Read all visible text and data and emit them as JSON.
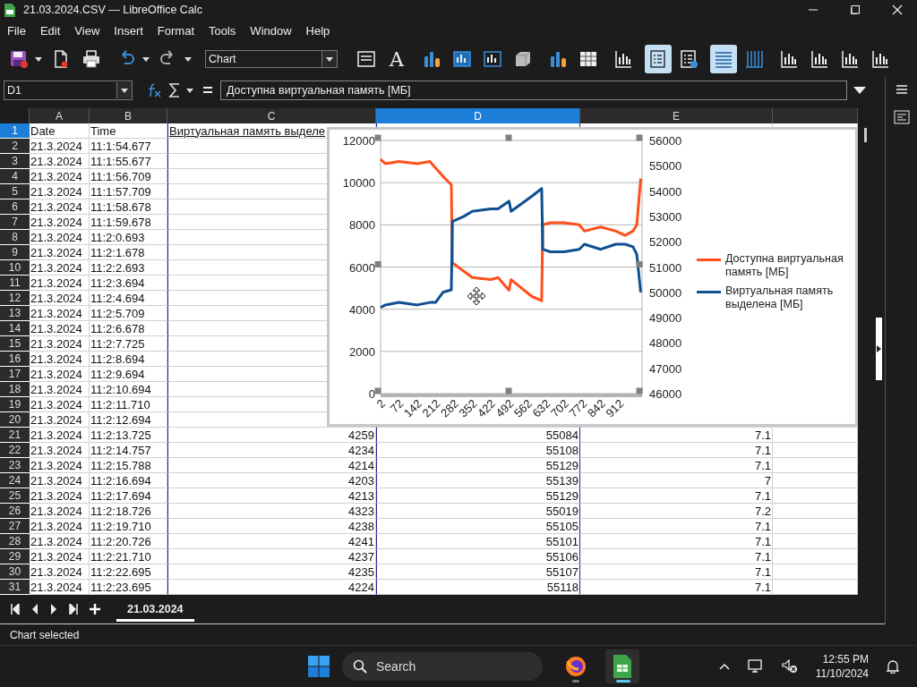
{
  "window": {
    "title": "21.03.2024.CSV — LibreOffice Calc"
  },
  "menu": [
    "File",
    "Edit",
    "View",
    "Insert",
    "Format",
    "Tools",
    "Window",
    "Help"
  ],
  "toolbar": [
    {
      "items": [
        {
          "kind": "floppy",
          "selected": false
        },
        {
          "kind": "pdf",
          "selected": false
        },
        {
          "kind": "printer",
          "selected": false
        }
      ]
    },
    {
      "items": [
        {
          "kind": "undo",
          "selected": false
        },
        {
          "kind": "redo",
          "selected": false
        }
      ]
    },
    {
      "items": [
        {
          "kind": "select",
          "value": "Chart"
        }
      ]
    },
    {
      "items": [
        {
          "kind": "format",
          "selected": false
        },
        {
          "kind": "glyph",
          "glyph": "A",
          "selected": false
        }
      ]
    },
    {
      "items": [
        {
          "kind": "chart-type",
          "selected": false
        },
        {
          "kind": "chart-area",
          "selected": false
        },
        {
          "kind": "chart-wall",
          "selected": false
        },
        {
          "kind": "cube",
          "selected": false
        }
      ]
    },
    {
      "items": [
        {
          "kind": "data-ranges",
          "selected": false
        },
        {
          "kind": "data-table",
          "selected": false
        }
      ]
    },
    {
      "items": [
        {
          "kind": "axes",
          "selected": false
        }
      ]
    },
    {
      "items": [
        {
          "kind": "legend",
          "selected": true
        },
        {
          "kind": "legend-options",
          "selected": false
        }
      ]
    },
    {
      "items": [
        {
          "kind": "hgrid",
          "selected": true
        },
        {
          "kind": "vgrid",
          "selected": false
        }
      ]
    },
    {
      "items": [
        {
          "kind": "axes",
          "selected": false
        },
        {
          "kind": "axes",
          "selected": false
        },
        {
          "kind": "axes",
          "selected": false
        },
        {
          "kind": "axes",
          "selected": false
        }
      ]
    }
  ],
  "name_box": {
    "value": "D1"
  },
  "formula": {
    "value": "Доступна виртуальная память [МБ]"
  },
  "sheet": {
    "columns": [
      {
        "label": "A",
        "selected": false,
        "in_chart_range": false
      },
      {
        "label": "B",
        "selected": false,
        "in_chart_range": false
      },
      {
        "label": "C",
        "selected": false,
        "in_chart_range": true
      },
      {
        "label": "D",
        "selected": true,
        "in_chart_range": true
      },
      {
        "label": "E",
        "selected": false,
        "in_chart_range": false
      }
    ],
    "rows": [
      {
        "number": "1",
        "selected": true,
        "a": "Date",
        "b": "Time",
        "c": "Виртуальная память выделе"
      },
      {
        "number": "2",
        "selected": false,
        "a": "21.3.2024",
        "b": "11:1:54.677"
      },
      {
        "number": "3",
        "selected": false,
        "a": "21.3.2024",
        "b": "11:1:55.677"
      },
      {
        "number": "4",
        "selected": false,
        "a": "21.3.2024",
        "b": "11:1:56.709"
      },
      {
        "number": "5",
        "selected": false,
        "a": "21.3.2024",
        "b": "11:1:57.709"
      },
      {
        "number": "6",
        "selected": false,
        "a": "21.3.2024",
        "b": "11:1:58.678"
      },
      {
        "number": "7",
        "selected": false,
        "a": "21.3.2024",
        "b": "11:1:59.678"
      },
      {
        "number": "8",
        "selected": false,
        "a": "21.3.2024",
        "b": "11:2:0.693"
      },
      {
        "number": "9",
        "selected": false,
        "a": "21.3.2024",
        "b": "11:2:1.678"
      },
      {
        "number": "10",
        "selected": false,
        "a": "21.3.2024",
        "b": "11:2:2.693"
      },
      {
        "number": "11",
        "selected": false,
        "a": "21.3.2024",
        "b": "11:2:3.694"
      },
      {
        "number": "12",
        "selected": false,
        "a": "21.3.2024",
        "b": "11:2:4.694"
      },
      {
        "number": "13",
        "selected": false,
        "a": "21.3.2024",
        "b": "11:2:5.709"
      },
      {
        "number": "14",
        "selected": false,
        "a": "21.3.2024",
        "b": "11:2:6.678"
      },
      {
        "number": "15",
        "selected": false,
        "a": "21.3.2024",
        "b": "11:2:7.725"
      },
      {
        "number": "16",
        "selected": false,
        "a": "21.3.2024",
        "b": "11:2:8.694"
      },
      {
        "number": "17",
        "selected": false,
        "a": "21.3.2024",
        "b": "11:2:9.694"
      },
      {
        "number": "18",
        "selected": false,
        "a": "21.3.2024",
        "b": "11:2:10.694"
      },
      {
        "number": "19",
        "selected": false,
        "a": "21.3.2024",
        "b": "11:2:11.710"
      },
      {
        "number": "20",
        "selected": false,
        "a": "21.3.2024",
        "b": "11:2:12.694"
      },
      {
        "number": "21",
        "selected": false,
        "a": "21.3.2024",
        "b": "11:2:13.725",
        "c": "4259",
        "d": "55084",
        "e": "7.1"
      },
      {
        "number": "22",
        "selected": false,
        "a": "21.3.2024",
        "b": "11:2:14.757",
        "c": "4234",
        "d": "55108",
        "e": "7.1"
      },
      {
        "number": "23",
        "selected": false,
        "a": "21.3.2024",
        "b": "11:2:15.788",
        "c": "4214",
        "d": "55129",
        "e": "7.1"
      },
      {
        "number": "24",
        "selected": false,
        "a": "21.3.2024",
        "b": "11:2:16.694",
        "c": "4203",
        "d": "55139",
        "e": "7"
      },
      {
        "number": "25",
        "selected": false,
        "a": "21.3.2024",
        "b": "11:2:17.694",
        "c": "4213",
        "d": "55129",
        "e": "7.1"
      },
      {
        "number": "26",
        "selected": false,
        "a": "21.3.2024",
        "b": "11:2:18.726",
        "c": "4323",
        "d": "55019",
        "e": "7.2"
      },
      {
        "number": "27",
        "selected": false,
        "a": "21.3.2024",
        "b": "11:2:19.710",
        "c": "4238",
        "d": "55105",
        "e": "7.1"
      },
      {
        "number": "28",
        "selected": false,
        "a": "21.3.2024",
        "b": "11:2:20.726",
        "c": "4241",
        "d": "55101",
        "e": "7.1"
      },
      {
        "number": "29",
        "selected": false,
        "a": "21.3.2024",
        "b": "11:2:21.710",
        "c": "4237",
        "d": "55106",
        "e": "7.1"
      },
      {
        "number": "30",
        "selected": false,
        "a": "21.3.2024",
        "b": "11:2:22.695",
        "c": "4235",
        "d": "55107",
        "e": "7.1"
      },
      {
        "number": "31",
        "selected": false,
        "a": "21.3.2024",
        "b": "11:2:23.695",
        "c": "4224",
        "d": "55118",
        "e": "7.1"
      }
    ]
  },
  "chart": {
    "chart_data": {
      "type": "line",
      "grid": true,
      "legend": "right",
      "xlim": [
        2,
        1000
      ],
      "ylim": [
        0,
        12000
      ],
      "y2lim": [
        46000,
        56000
      ],
      "xticks": [
        2,
        72,
        142,
        212,
        282,
        352,
        422,
        492,
        562,
        632,
        702,
        772,
        842,
        912
      ],
      "yticks": [
        0,
        2000,
        4000,
        6000,
        8000,
        10000,
        12000
      ],
      "y2ticks": [
        46000,
        47000,
        48000,
        49000,
        50000,
        51000,
        52000,
        53000,
        54000,
        55000,
        56000
      ],
      "x": [
        2,
        20,
        72,
        142,
        190,
        212,
        240,
        272,
        276,
        320,
        352,
        422,
        450,
        492,
        500,
        540,
        580,
        617,
        621,
        650,
        702,
        760,
        780,
        842,
        900,
        935,
        965,
        980,
        995
      ],
      "series": [
        {
          "name": "Доступна виртуальная память [МБ]",
          "color": "#ff4f1a",
          "axis": "y",
          "values": [
            11100,
            10900,
            11000,
            10900,
            11000,
            10700,
            10300,
            9900,
            6200,
            5800,
            5500,
            5400,
            5500,
            4900,
            5400,
            5000,
            4600,
            4400,
            8000,
            8100,
            8100,
            8000,
            7700,
            7900,
            7700,
            7500,
            7700,
            8000,
            10200
          ]
        },
        {
          "name": "Виртуальная память выделена [МБ]",
          "color": "#0f4f8f",
          "axis": "y2",
          "values": [
            49400,
            49500,
            49600,
            49500,
            49600,
            49600,
            50000,
            50100,
            52800,
            53000,
            53200,
            53300,
            53300,
            53600,
            53200,
            53500,
            53800,
            54100,
            51700,
            51600,
            51600,
            51700,
            51900,
            51700,
            51900,
            51900,
            51800,
            51500,
            50000
          ]
        }
      ]
    }
  },
  "sheet_tabs": [
    {
      "label": "21.03.2024",
      "selected": true
    }
  ],
  "status_bar": {
    "text": "Chart selected"
  },
  "taskbar": {
    "search": "Search",
    "apps": [
      {
        "kind": "browser",
        "active": false
      },
      {
        "kind": "spreadsheet",
        "active": true
      }
    ],
    "time": "12:55 PM",
    "date": "11/10/2024"
  }
}
